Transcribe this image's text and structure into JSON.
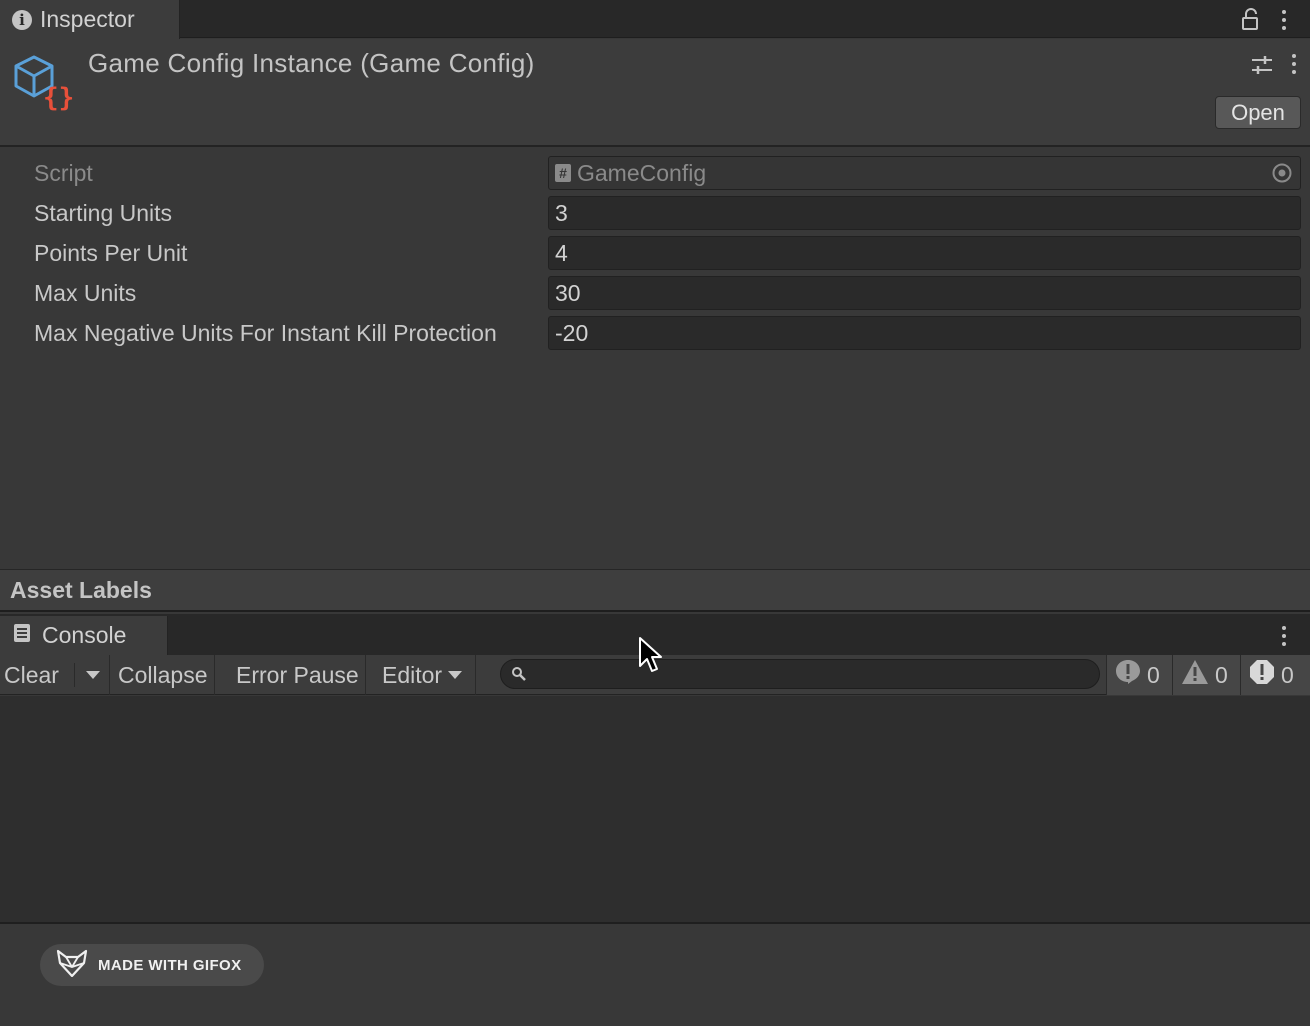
{
  "inspector": {
    "tab_label": "Inspector",
    "asset_title": "Game Config Instance (Game Config)",
    "open_button": "Open",
    "script_label": "Script",
    "script_value": "GameConfig",
    "properties": [
      {
        "label": "Starting Units",
        "value": "3"
      },
      {
        "label": "Points Per Unit",
        "value": "4"
      },
      {
        "label": "Max Units",
        "value": "30"
      },
      {
        "label": "Max Negative Units For Instant Kill Protection",
        "value": "-20"
      }
    ],
    "asset_labels": "Asset Labels"
  },
  "console": {
    "tab_label": "Console",
    "clear_label": "Clear",
    "collapse_label": "Collapse",
    "error_pause_label": "Error Pause",
    "editor_label": "Editor",
    "search_value": "",
    "counts": {
      "info": "0",
      "warning": "0",
      "error": "0"
    }
  },
  "watermark": "MADE WITH GIFOX",
  "colors": {
    "accent_blue": "#5aa0d8",
    "accent_red": "#e8503a"
  }
}
